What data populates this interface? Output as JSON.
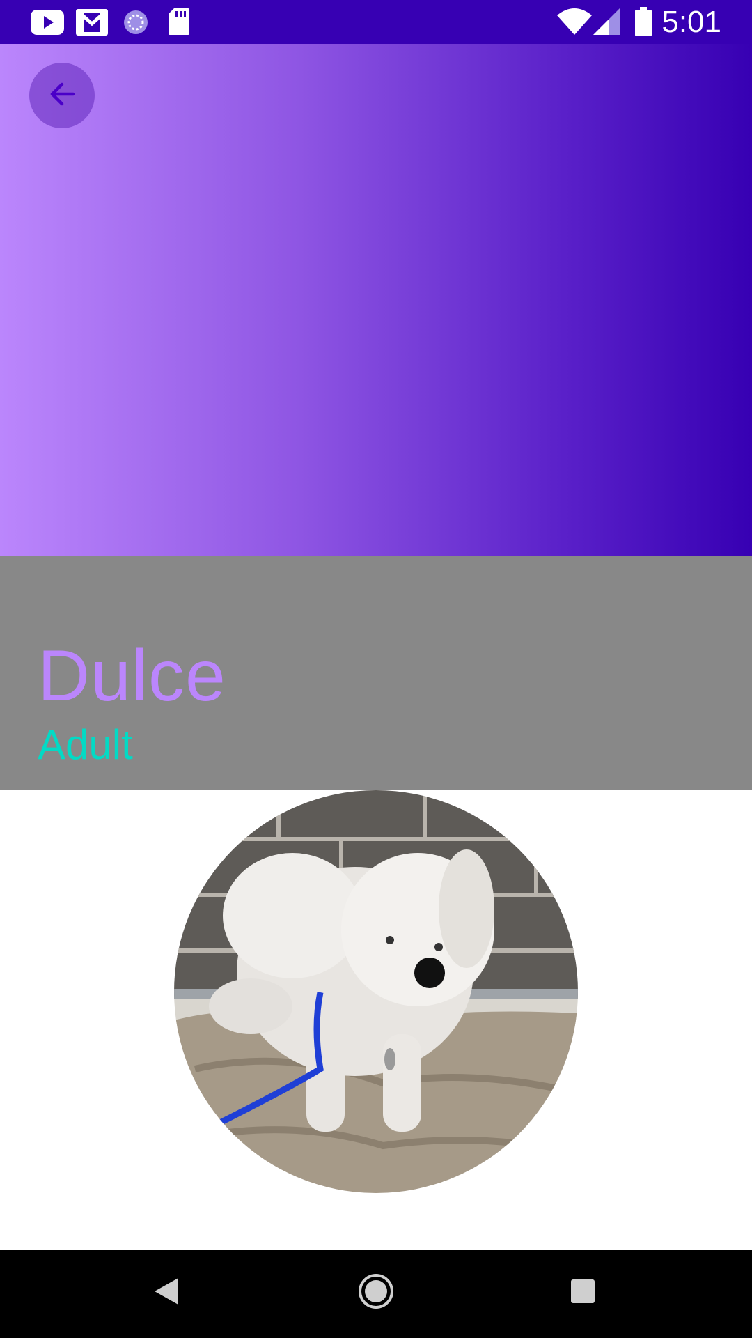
{
  "status_bar": {
    "time": "5:01",
    "left_icons": [
      "youtube-icon",
      "gmail-icon",
      "sync-progress-icon",
      "sd-card-icon"
    ],
    "right_icons": [
      "wifi-icon",
      "cellular-signal-icon",
      "battery-icon"
    ],
    "background_color": "#3700b3"
  },
  "header": {
    "gradient_start": "#bb86fc",
    "gradient_end": "#3700b3",
    "back_button_icon": "arrow-back-icon"
  },
  "pet": {
    "name": "Dulce",
    "age": "Adult",
    "name_color": "#bb86fc",
    "age_color": "#03dac5",
    "photo_icon": "pet-photo"
  },
  "nav_bar": {
    "buttons": [
      "back-triangle-icon",
      "home-circle-icon",
      "recents-square-icon"
    ]
  }
}
